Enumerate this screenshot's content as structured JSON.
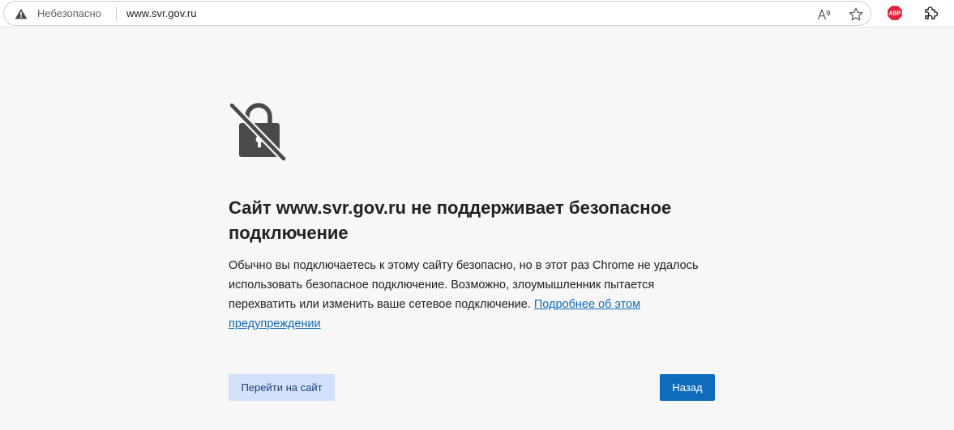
{
  "address_bar": {
    "security_label": "Небезопасно",
    "url": "www.svr.gov.ru",
    "icons": [
      "warning-icon",
      "read-aloud-icon",
      "favorite-star-icon",
      "adblock-plus-icon",
      "extensions-icon"
    ],
    "abp_badge": "ABP"
  },
  "error_page": {
    "icon": "broken-lock-icon",
    "heading": "Сайт www.svr.gov.ru не поддерживает безопасное подключение",
    "body_text": "Обычно вы подключаетесь к этому сайту безопасно, но в этот раз Chrome не удалось использовать безопасное подключение. Возможно, злоумышленник пытается перехватить или изменить ваше сетевое подключение. ",
    "learn_more_link": "Подробнее об этом предупреждении",
    "proceed_button": "Перейти на сайт",
    "back_button": "Назад"
  },
  "colors": {
    "page_background": "#f7f7f7",
    "primary_button": "#0f6cbd",
    "secondary_button": "#d1e2fa",
    "link": "#0f6cbd",
    "abp_red": "#e8243c"
  }
}
